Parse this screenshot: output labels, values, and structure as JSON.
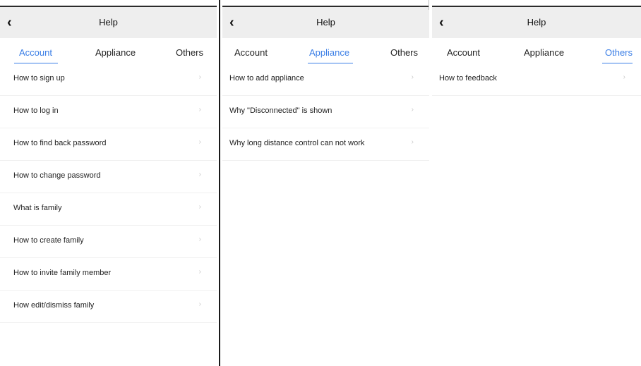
{
  "colors": {
    "accent": "#3a7ee6",
    "header_bg": "#eeeeee",
    "chevron": "#c9c9c9"
  },
  "icons": {
    "back": "‹",
    "chevron": "›"
  },
  "panels": [
    {
      "title": "Help",
      "tabs": [
        "Account",
        "Appliance",
        "Others"
      ],
      "active_tab": "Account",
      "items": [
        "How to sign up",
        "How to log in",
        "How to find back password",
        "How to change password",
        "What is family",
        "How to create family",
        "How to invite family member",
        "How edit/dismiss family"
      ]
    },
    {
      "title": "Help",
      "tabs": [
        "Account",
        "Appliance",
        "Others"
      ],
      "active_tab": "Appliance",
      "items": [
        "How to add appliance",
        "Why \"Disconnected\" is shown",
        "Why long distance control can not work"
      ]
    },
    {
      "title": "Help",
      "tabs": [
        "Account",
        "Appliance",
        "Others"
      ],
      "active_tab": "Others",
      "items": [
        "How to feedback"
      ]
    }
  ]
}
